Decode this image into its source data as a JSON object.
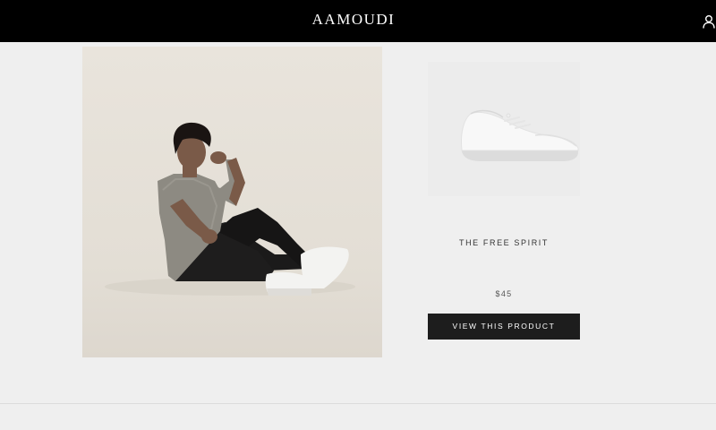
{
  "header": {
    "logo_text": "AAMOUDI",
    "account_icon": "user-icon"
  },
  "product": {
    "lifestyle_image": "model-seated-wearing-white-sneakers",
    "thumbnail_image": "white-sneaker",
    "name": "THE FREE SPIRIT",
    "price": "$45",
    "cta_label": "VIEW THIS PRODUCT"
  },
  "colors": {
    "header_bg": "#000000",
    "page_bg": "#efefef",
    "button_bg": "#1d1d1d",
    "button_text": "#ffffff"
  }
}
